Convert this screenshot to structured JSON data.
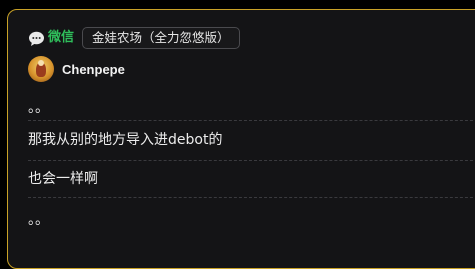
{
  "source": {
    "icon": "wechat-bubble-icon",
    "name": "微信",
    "group": "金娃农场（全力忽悠版）",
    "accent_color": "#2fbf5b"
  },
  "user": {
    "avatar": "avatar-icon",
    "name": "Chenpepe"
  },
  "messages": [
    "。。",
    "那我从别的地方导入进debot的",
    "也会一样啊",
    "。。"
  ],
  "theme": {
    "border_color": "#c9a227",
    "background": "#141416"
  }
}
